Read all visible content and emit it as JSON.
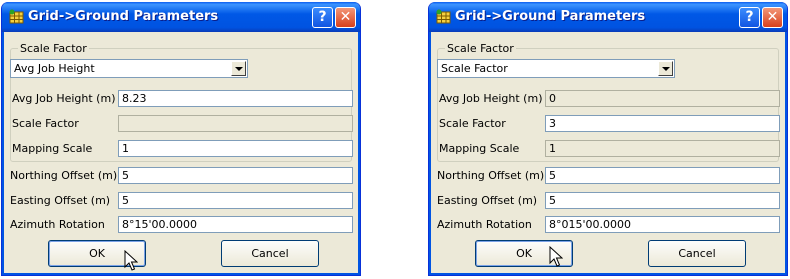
{
  "dialogs": [
    {
      "title": "Grid->Ground Parameters",
      "scale_group_label": "Scale Factor",
      "method_selected": "Avg Job Height",
      "fields": {
        "avg_job_height": {
          "label": "Avg Job Height (m)",
          "value": "8.23",
          "enabled": true
        },
        "scale_factor": {
          "label": "Scale Factor",
          "value": "",
          "enabled": false
        },
        "mapping_scale": {
          "label": "Mapping Scale",
          "value": "1",
          "enabled": true
        },
        "northing_offset": {
          "label": "Northing Offset (m)",
          "value": "5",
          "enabled": true
        },
        "easting_offset": {
          "label": "Easting Offset (m)",
          "value": "5",
          "enabled": true
        },
        "azimuth_rotation": {
          "label": "Azimuth Rotation",
          "value": "8°15'00.0000",
          "enabled": true
        }
      },
      "ok_label": "OK",
      "cancel_label": "Cancel"
    },
    {
      "title": "Grid->Ground Parameters",
      "scale_group_label": "Scale Factor",
      "method_selected": "Scale Factor",
      "fields": {
        "avg_job_height": {
          "label": "Avg Job Height (m)",
          "value": "0",
          "enabled": false
        },
        "scale_factor": {
          "label": "Scale Factor",
          "value": "3",
          "enabled": true
        },
        "mapping_scale": {
          "label": "Mapping Scale",
          "value": "1",
          "enabled": false
        },
        "northing_offset": {
          "label": "Northing Offset (m)",
          "value": "5",
          "enabled": true
        },
        "easting_offset": {
          "label": "Easting Offset (m)",
          "value": "5",
          "enabled": true
        },
        "azimuth_rotation": {
          "label": "Azimuth Rotation",
          "value": "8°015'00.0000",
          "enabled": true
        }
      },
      "ok_label": "OK",
      "cancel_label": "Cancel"
    }
  ],
  "titlebar_buttons": {
    "help": "?",
    "close": "✕"
  },
  "icons": {
    "app": "app-grid-icon",
    "help": "help-icon",
    "close": "close-icon",
    "dropdown": "chevron-down-icon",
    "cursor": "mouse-pointer-icon"
  },
  "colors": {
    "dialog_face": "#ece9d8",
    "titlebar": "#0058e6",
    "close": "#d8401c",
    "field_border": "#7f9db9"
  }
}
